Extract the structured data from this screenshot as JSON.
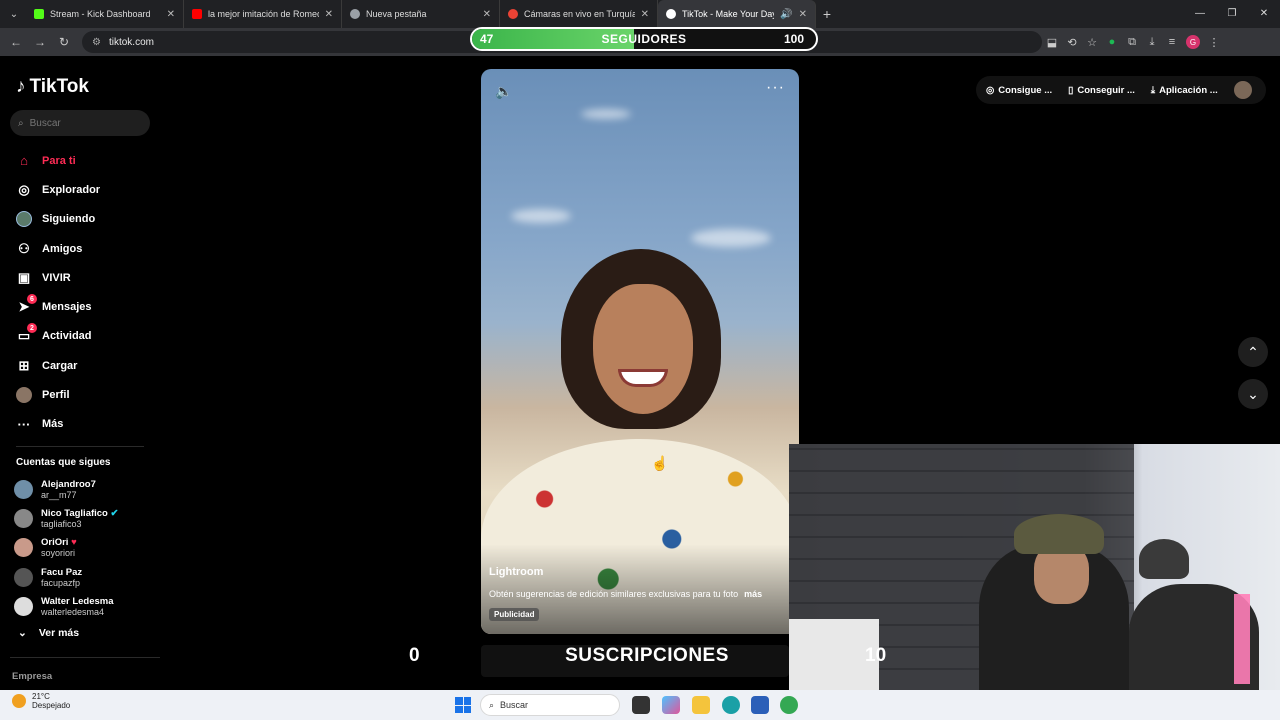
{
  "browser": {
    "tabs": [
      {
        "label": "Stream - Kick Dashboard",
        "color": "#53fc18"
      },
      {
        "label": "la mejor imitación de Romeo s",
        "color": "#ff0000"
      },
      {
        "label": "Nueva pestaña",
        "color": "#9aa0a6"
      },
      {
        "label": "Cámaras en vivo en Turquía",
        "color": "#ea4335"
      },
      {
        "label": "TikTok - Make Your Day",
        "color": "#ffffff"
      }
    ],
    "url": "tiktok.com"
  },
  "followers_goal": {
    "current": "47",
    "title": "SEGUIDORES",
    "target": "100",
    "progress": 0.47
  },
  "tiktok": {
    "logo": "TikTok",
    "search_placeholder": "Buscar",
    "nav": [
      {
        "label": "Para ti",
        "icon": "home-icon"
      },
      {
        "label": "Explorador",
        "icon": "compass-icon"
      },
      {
        "label": "Siguiendo",
        "icon": "following-avatar-icon"
      },
      {
        "label": "Amigos",
        "icon": "friends-icon"
      },
      {
        "label": "VIVIR",
        "icon": "live-icon"
      },
      {
        "label": "Mensajes",
        "icon": "send-icon",
        "badge": "6"
      },
      {
        "label": "Actividad",
        "icon": "activity-icon",
        "badge": "2"
      },
      {
        "label": "Cargar",
        "icon": "upload-icon"
      },
      {
        "label": "Perfil",
        "icon": "profile-avatar-icon"
      },
      {
        "label": "Más",
        "icon": "more-icon"
      }
    ],
    "following_title": "Cuentas que sigues",
    "following": [
      {
        "name": "Alejandroo7",
        "handle": "ar__m77"
      },
      {
        "name": "Nico Tagliafico",
        "handle": "tagliafico3"
      },
      {
        "name": "OriOri",
        "handle": "soyoriori"
      },
      {
        "name": "Facu Paz",
        "handle": "facupazfp"
      },
      {
        "name": "Walter Ledesma",
        "handle": "walterledesma4"
      }
    ],
    "see_more": "Ver más",
    "footer": "Empresa",
    "video": {
      "author": "Lightroom",
      "description": "Obtén sugerencias de edición similares exclusivas para tu foto",
      "more": "más",
      "ad": "Publicidad"
    },
    "top_buttons": [
      "Consigue ...",
      "Conseguir ...",
      "Aplicación ..."
    ]
  },
  "subscriptions": {
    "left": "0",
    "title": "SUSCRIPCIONES",
    "right": "10"
  },
  "taskbar": {
    "temp": "21°C",
    "weather": "Despejado",
    "search": "Buscar"
  }
}
